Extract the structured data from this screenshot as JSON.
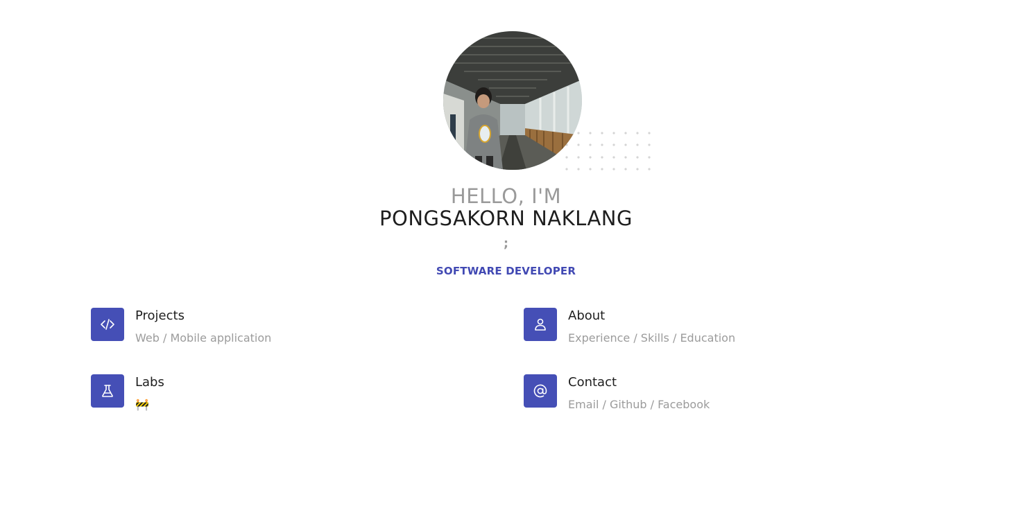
{
  "header": {
    "greeting": "HELLO, I'M",
    "name": "PONGSAKORN NAKLANG",
    "separator": ";",
    "role": "SOFTWARE DEVELOPER"
  },
  "theme": {
    "accent": "#454fb6",
    "role_color": "#4149b3",
    "muted_text": "#9b9b9b",
    "dark_text": "#1e1e1e"
  },
  "cards": [
    {
      "title": "Projects",
      "subtitle": "Web / Mobile application",
      "icon": "code-icon"
    },
    {
      "title": "About",
      "subtitle": "Experience / Skills / Education",
      "icon": "user-icon"
    },
    {
      "title": "Labs",
      "subtitle": "🚧",
      "icon": "flask-icon"
    },
    {
      "title": "Contact",
      "subtitle": "Email / Github / Facebook",
      "icon": "at-sign-icon"
    }
  ]
}
